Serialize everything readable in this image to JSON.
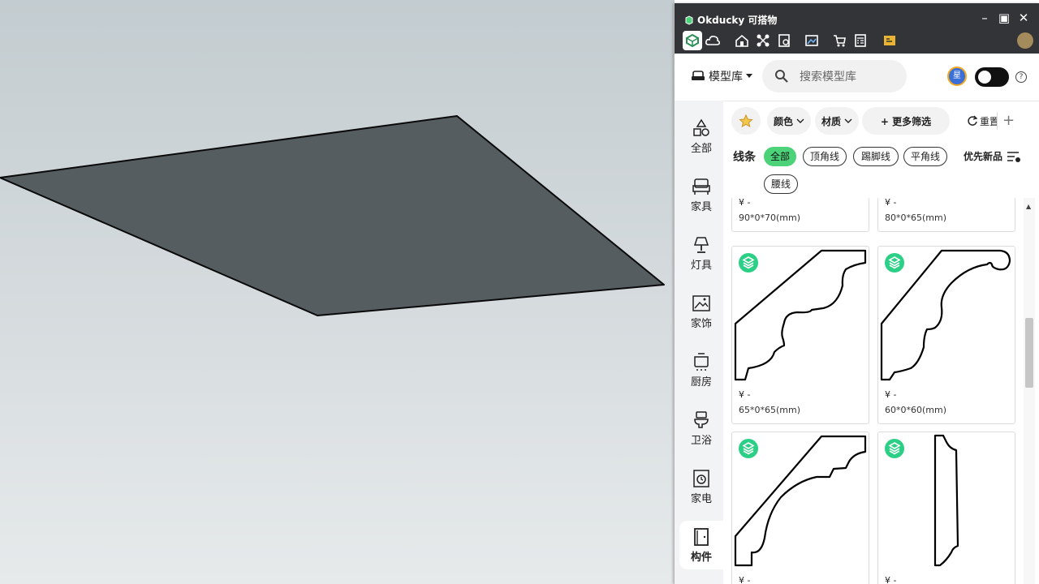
{
  "app": {
    "title": "Okducky 可搭物"
  },
  "window_controls": {
    "minimize": "–",
    "maximize": "▣",
    "close": "✕"
  },
  "toolbar": {
    "icons": [
      "model-library-icon",
      "cloud-icon",
      "house-icon",
      "connections-icon",
      "document-icon",
      "image-icon",
      "cart-icon",
      "calculator-icon",
      "render-icon"
    ]
  },
  "header": {
    "library_label": "模型库",
    "search_placeholder": "搜索模型库",
    "user_badge": "星",
    "help": "?"
  },
  "sidebar": {
    "items": [
      {
        "label": "全部",
        "icon": "shapes-icon"
      },
      {
        "label": "家具",
        "icon": "chair-icon"
      },
      {
        "label": "灯具",
        "icon": "lamp-icon"
      },
      {
        "label": "家饰",
        "icon": "picture-icon"
      },
      {
        "label": "厨房",
        "icon": "stove-icon"
      },
      {
        "label": "卫浴",
        "icon": "toilet-icon"
      },
      {
        "label": "家电",
        "icon": "washer-icon"
      },
      {
        "label": "构件",
        "icon": "door-icon"
      }
    ],
    "active_index": 7
  },
  "filters": {
    "color": "颜色",
    "material": "材质",
    "more": "+ 更多筛选",
    "reset": "重置",
    "add": "+"
  },
  "category": {
    "title": "线条",
    "chips": [
      "全部",
      "顶角线",
      "踢脚线",
      "平角线",
      "腰线"
    ],
    "active_index": 0,
    "prefer_new": "优先新品"
  },
  "products": [
    {
      "price": "¥ -",
      "dims": "90*0*70(mm)"
    },
    {
      "price": "¥ -",
      "dims": "80*0*65(mm)"
    },
    {
      "price": "¥ -",
      "dims": "65*0*65(mm)"
    },
    {
      "price": "¥ -",
      "dims": "60*0*60(mm)"
    },
    {
      "price": "¥ -",
      "dims": ""
    },
    {
      "price": "¥ -",
      "dims": ""
    }
  ],
  "colors": {
    "accent": "#4cd37a",
    "titlebar": "#333437",
    "badge": "#2ccf86",
    "plane": "#555d61"
  }
}
